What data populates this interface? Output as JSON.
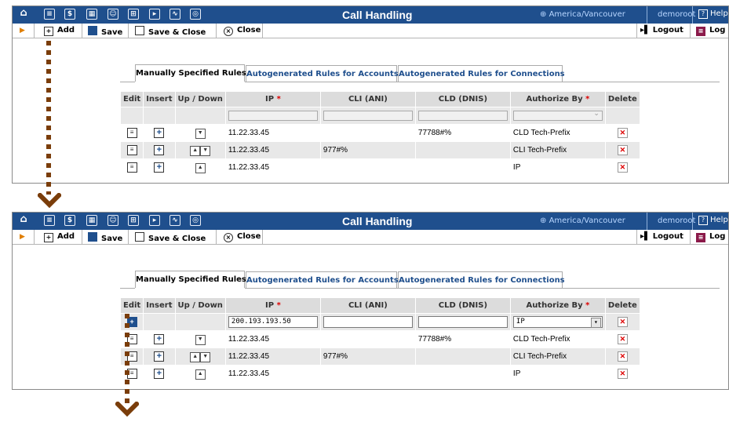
{
  "topbar": {
    "title": "Call Handling",
    "timezone": "America/Vancouver",
    "user": "demoroot",
    "help": "Help",
    "icons": [
      "home-icon",
      "list-icon",
      "dollar-icon",
      "grid-icon",
      "person-icon",
      "router-icon",
      "arrow-box-icon",
      "chart-icon",
      "search-icon"
    ]
  },
  "toolbar": {
    "add": "Add",
    "save": "Save",
    "save_close": "Save & Close",
    "close": "Close",
    "logout": "Logout",
    "log": "Log"
  },
  "tabs": [
    "Manually Specified Rules",
    "Autogenerated Rules for Accounts",
    "Autogenerated Rules for Connections"
  ],
  "columns": {
    "edit": "Edit",
    "insert": "Insert",
    "updown": "Up / Down",
    "ip": "IP",
    "cli": "CLI (ANI)",
    "cld": "CLD (DNIS)",
    "authorize": "Authorize By",
    "delete": "Delete"
  },
  "rows": [
    {
      "ip": "11.22.33.45",
      "cli": "",
      "cld": "77788#%",
      "auth": "CLD Tech-Prefix"
    },
    {
      "ip": "11.22.33.45",
      "cli": "977#%",
      "cld": "",
      "auth": "CLI Tech-Prefix"
    },
    {
      "ip": "11.22.33.45",
      "cli": "",
      "cld": "",
      "auth": "IP"
    }
  ],
  "new_row": {
    "ip": "200.193.193.50",
    "cli": "",
    "cld": "",
    "auth": "IP"
  },
  "colors": {
    "header_blue": "#1f4f8d",
    "arrow_brown": "#7a3d0a",
    "delete_red": "#dd0000"
  }
}
